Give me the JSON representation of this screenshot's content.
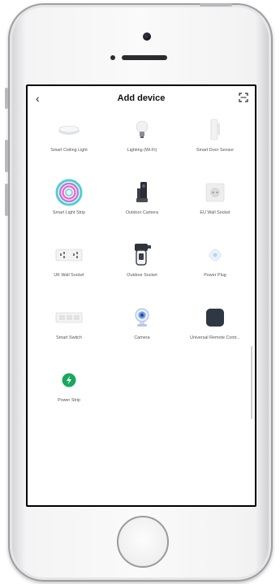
{
  "header": {
    "back_glyph": "‹",
    "title": "Add device"
  },
  "devices": [
    {
      "label": "Smart Ceiling Light",
      "icon": "ceiling-light-icon"
    },
    {
      "label": "Lighting (Wi-Fi)",
      "icon": "light-bulb-icon"
    },
    {
      "label": "Smart Door Sensor",
      "icon": "door-sensor-icon"
    },
    {
      "label": "Smart Light Strip",
      "icon": "light-strip-icon"
    },
    {
      "label": "Outdoor Camera",
      "icon": "outdoor-camera-icon"
    },
    {
      "label": "EU Wall Socket",
      "icon": "eu-socket-icon"
    },
    {
      "label": "UK Wall Socket",
      "icon": "uk-socket-icon"
    },
    {
      "label": "Outdoor Socket",
      "icon": "outdoor-socket-icon"
    },
    {
      "label": "Power Plug",
      "icon": "power-plug-icon"
    },
    {
      "label": "Smart Switch",
      "icon": "smart-switch-icon"
    },
    {
      "label": "Camera",
      "icon": "camera-icon"
    },
    {
      "label": "Universal Remote Contr...",
      "icon": "remote-control-icon"
    },
    {
      "label": "Power Strip",
      "icon": "power-strip-icon"
    }
  ],
  "colors": {
    "accent_green": "#1aa85f",
    "camera_blue": "#6c9ee8"
  }
}
